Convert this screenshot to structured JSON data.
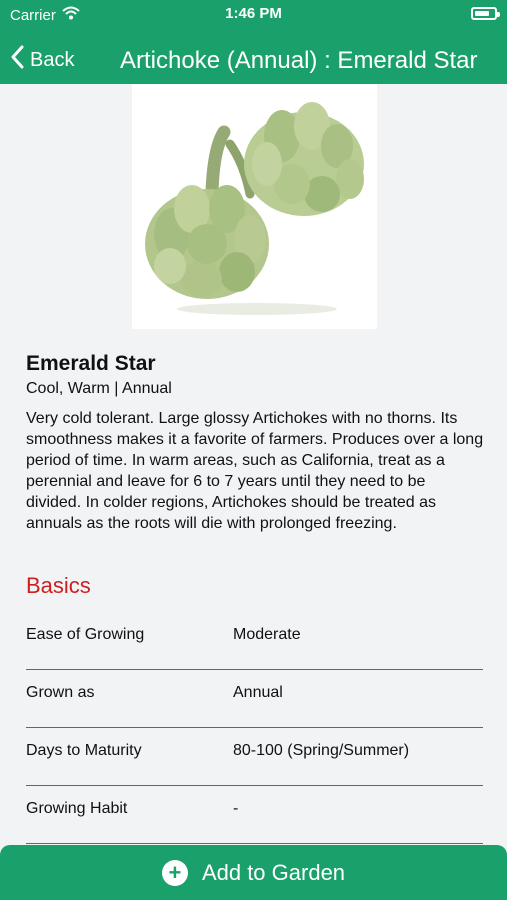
{
  "status_bar": {
    "carrier": "Carrier",
    "time": "1:46 PM",
    "battery_level": 0.8
  },
  "nav": {
    "back_label": "Back",
    "title": "Artichoke (Annual) : Emerald Star"
  },
  "plant": {
    "image_icon": "artichoke-photo",
    "name": "Emerald Star",
    "subtitle": "Cool, Warm | Annual",
    "description": "Very cold tolerant. Large glossy Artichokes with no thorns. Its smoothness makes it a favorite of farmers. Produces over a long period of time. In warm areas, such as California, treat as a perennial and leave for 6 to 7 years until they need to be divided. In colder regions, Artichokes should be treated as annuals as the roots will die with prolonged freezing."
  },
  "basics": {
    "heading": "Basics",
    "rows": [
      {
        "label": "Ease of Growing",
        "value": "Moderate"
      },
      {
        "label": "Grown as",
        "value": "Annual"
      },
      {
        "label": "Days to Maturity",
        "value": "80-100 (Spring/Summer)"
      },
      {
        "label": "Growing Habit",
        "value": "-"
      }
    ]
  },
  "cta": {
    "label": "Add to Garden",
    "icon": "plus-circle-icon"
  },
  "colors": {
    "brand": "#1aa06a",
    "section": "#cc1f1f"
  }
}
